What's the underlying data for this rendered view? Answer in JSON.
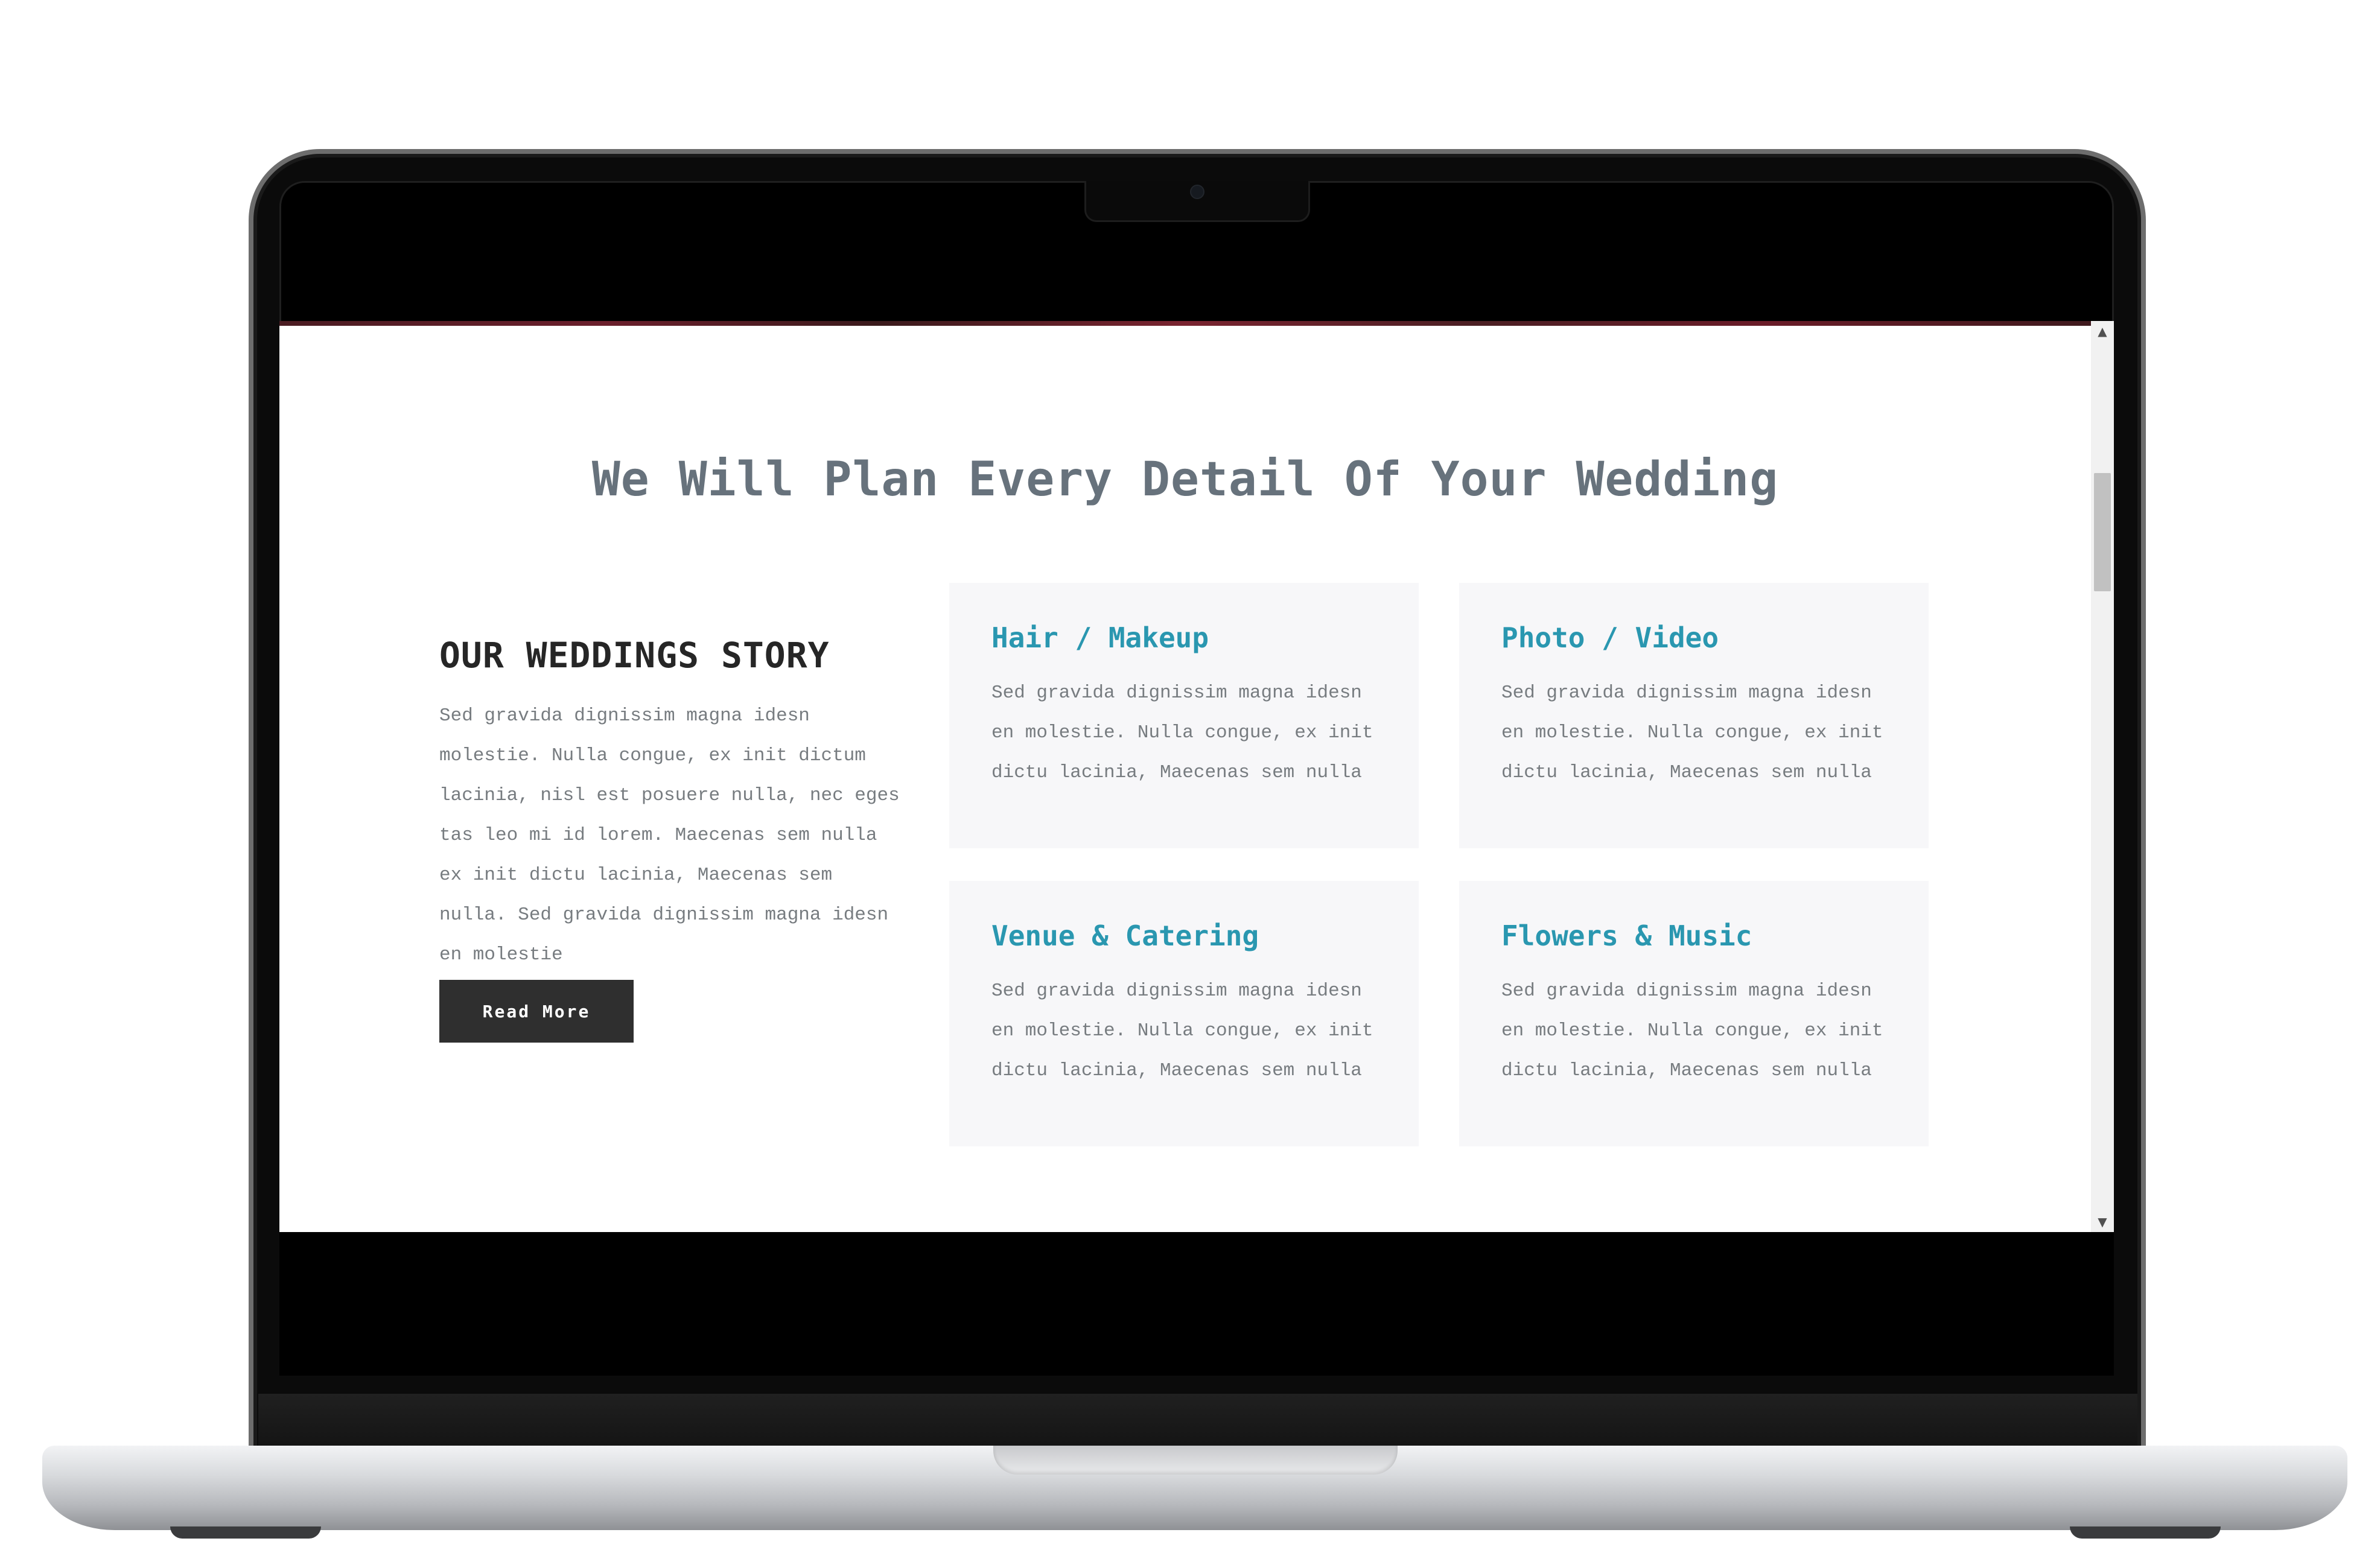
{
  "page": {
    "title": "We Will Plan Every Detail Of Your Wedding"
  },
  "story": {
    "heading": "OUR WEDDINGS STORY",
    "text": "Sed gravida dignissim magna idesn molestie. Nulla congue, ex init dictum lacinia, nisl est posuere nulla, nec eges tas leo mi id lorem. Maecenas sem nulla ex init dictu lacinia, Maecenas sem nulla. Sed gravida dignissim magna idesn en molestie",
    "button_label": "Read More"
  },
  "services": [
    {
      "title": "Hair / Makeup",
      "text": "Sed gravida dignissim magna idesn en molestie. Nulla congue, ex init dictu lacinia, Maecenas sem nulla"
    },
    {
      "title": "Photo / Video",
      "text": "Sed gravida dignissim magna idesn en molestie. Nulla congue, ex init dictu lacinia, Maecenas sem nulla"
    },
    {
      "title": "Venue & Catering",
      "text": "Sed gravida dignissim magna idesn en molestie. Nulla congue, ex init dictu lacinia, Maecenas sem nulla"
    },
    {
      "title": "Flowers & Music",
      "text": "Sed gravida dignissim magna idesn en molestie. Nulla congue, ex init dictu lacinia, Maecenas sem nulla"
    }
  ],
  "scrollbar": {
    "up_arrow": "▲",
    "down_arrow": "▼"
  },
  "colors": {
    "accent": "#2a97b0",
    "heading": "#67727c",
    "button_bg": "#2f2f2f",
    "card_bg": "#f7f7f9"
  },
  "icons": {
    "camera": "camera-icon",
    "scroll_up": "chevron-up-icon",
    "scroll_down": "chevron-down-icon"
  }
}
